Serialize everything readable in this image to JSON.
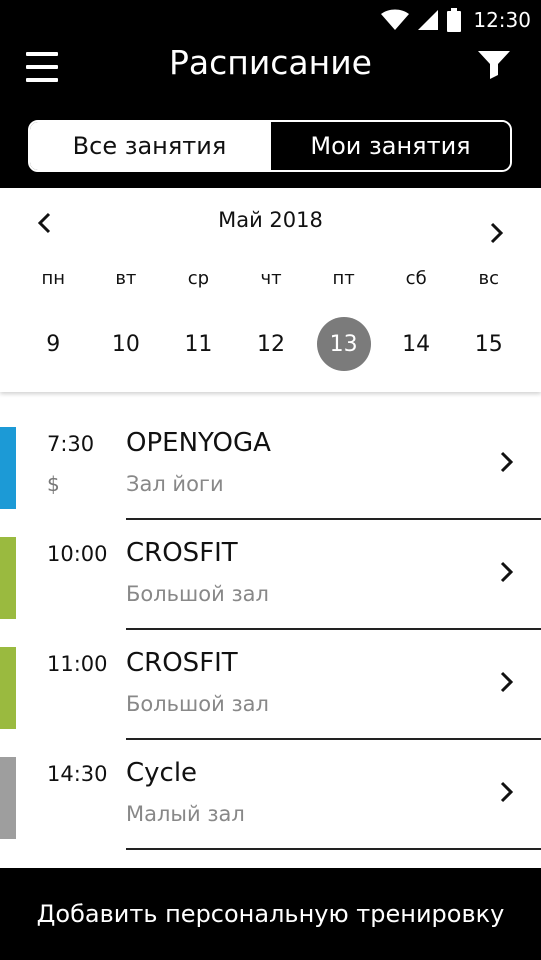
{
  "status_bar": {
    "time": "12:30",
    "icons": [
      "wifi-icon",
      "signal-icon",
      "battery-icon"
    ]
  },
  "app_bar": {
    "title": "Расписание",
    "menu_icon": "menu-icon",
    "filter_icon": "filter-icon"
  },
  "tabs": {
    "all": "Все занятия",
    "mine": "Мои занятия",
    "active": "all"
  },
  "calendar": {
    "month": "Май 2018",
    "weekdays": [
      "пн",
      "вт",
      "ср",
      "чт",
      "пт",
      "сб",
      "вс"
    ],
    "dates": [
      "9",
      "10",
      "11",
      "12",
      "13",
      "14",
      "15"
    ],
    "selected": "13"
  },
  "sessions": [
    {
      "time": "7:30",
      "price": "$",
      "title": "OPENYOGA",
      "room": "Зал йоги",
      "color": "#1c9ad6"
    },
    {
      "time": "10:00",
      "price": "",
      "title": "CROSFIT",
      "room": "Большой зал",
      "color": "#9aba3f"
    },
    {
      "time": "11:00",
      "price": "",
      "title": "CROSFIT",
      "room": "Большой зал",
      "color": "#9aba3f"
    },
    {
      "time": "14:30",
      "price": "",
      "title": "Cycle",
      "room": "Малый зал",
      "color": "#9e9e9e"
    }
  ],
  "bottom_button": {
    "label": "Добавить персональную тренировку"
  },
  "colors": {
    "bar": "#000000",
    "selected_date": "#7b7b7b"
  }
}
